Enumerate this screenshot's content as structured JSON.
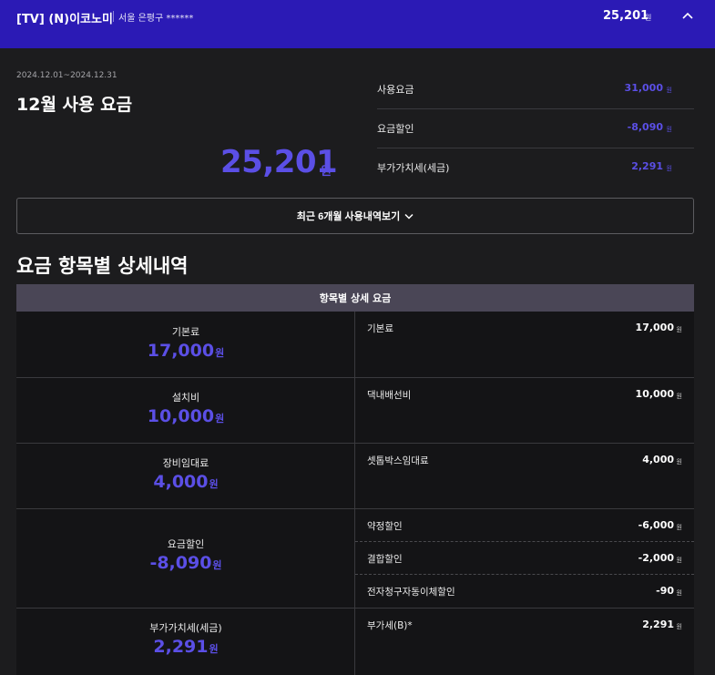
{
  "header": {
    "title": "[TV] (N)이코노미",
    "address": "서울 은평구 ******",
    "total": "25,201",
    "total_unit": "원"
  },
  "summary": {
    "period": "2024.12.01~2024.12.31",
    "title": "12월 사용 요금",
    "amount": "25,201",
    "unit": "원",
    "rows": [
      {
        "label": "사용요금",
        "value": "31,000",
        "unit": "원"
      },
      {
        "label": "요금할인",
        "value": "-8,090",
        "unit": "원"
      },
      {
        "label": "부가가치세(세금)",
        "value": "2,291",
        "unit": "원"
      }
    ]
  },
  "history_button": "최근 6개월 사용내역보기",
  "details": {
    "section_title": "요금 항목별 상세내역",
    "table_header": "항목별 상세 요금",
    "groups": [
      {
        "category": "기본료",
        "amount": "17,000",
        "unit": "원",
        "items": [
          {
            "name": "기본료",
            "value": "17,000",
            "unit": "원"
          }
        ]
      },
      {
        "category": "설치비",
        "amount": "10,000",
        "unit": "원",
        "items": [
          {
            "name": "댁내배선비",
            "value": "10,000",
            "unit": "원"
          }
        ]
      },
      {
        "category": "장비임대료",
        "amount": "4,000",
        "unit": "원",
        "items": [
          {
            "name": "셋톱박스임대료",
            "value": "4,000",
            "unit": "원"
          }
        ]
      },
      {
        "category": "요금할인",
        "amount": "-8,090",
        "unit": "원",
        "items": [
          {
            "name": "약정할인",
            "value": "-6,000",
            "unit": "원"
          },
          {
            "name": "결합할인",
            "value": "-2,000",
            "unit": "원"
          },
          {
            "name": "전자청구자동이체할인",
            "value": "-90",
            "unit": "원"
          }
        ]
      },
      {
        "category": "부가가치세(세금)",
        "amount": "2,291",
        "unit": "원",
        "items": [
          {
            "name": "부가세(B)*",
            "value": "2,291",
            "unit": "원"
          }
        ]
      }
    ]
  },
  "icons": {
    "collapse": "chevron-up-icon",
    "expand": "chevron-down-icon"
  },
  "colors": {
    "header_bg": "#2b1ab5",
    "accent": "#5b4fe6",
    "page_bg": "#1c1c1e"
  }
}
